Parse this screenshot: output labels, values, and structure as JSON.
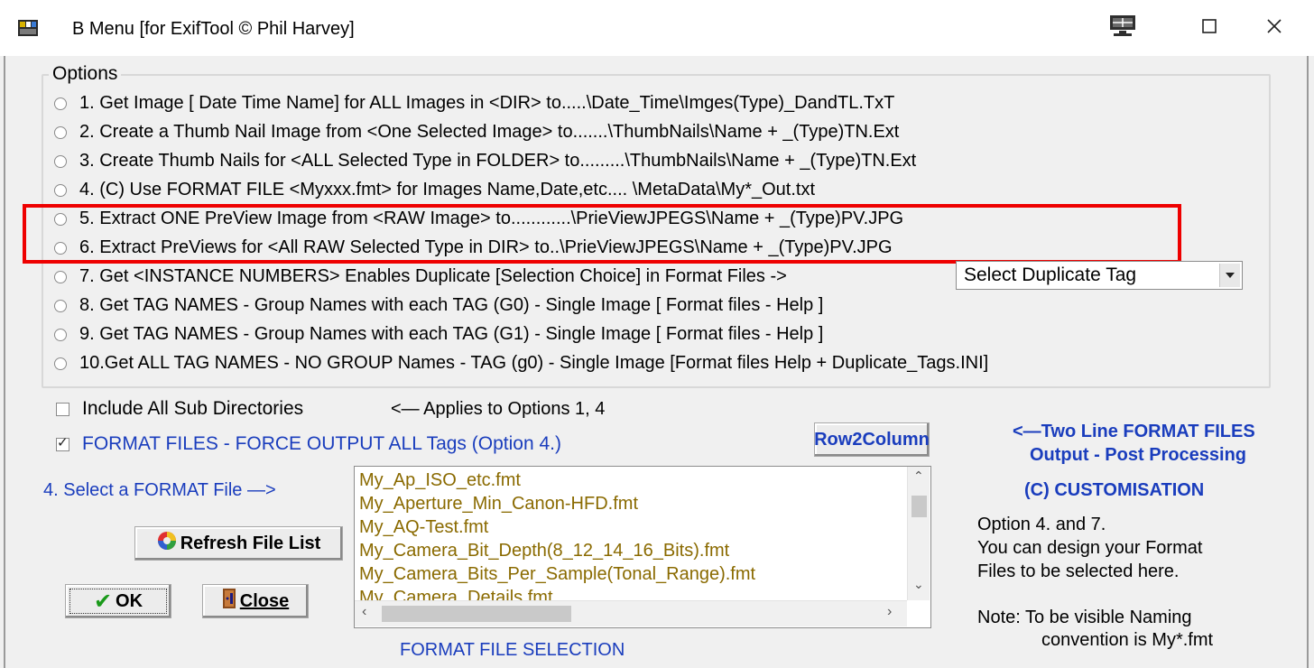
{
  "window": {
    "title": "B Menu  [for ExifTool © Phil Harvey]",
    "min_icon": "minimize-icon",
    "max_icon": "maximize-icon",
    "close_icon": "close-icon"
  },
  "options": {
    "legend": "Options",
    "items": [
      "1. Get Image [ Date Time  Name] for ALL Images in <DIR>    to.....\\Date_Time\\Imges(Type)_DandTL.TxT",
      "2. Create a Thumb Nail Image from <One Selected Image> to.......\\ThumbNails\\Name + _(Type)TN.Ext",
      "3. Create    Thumb Nails for <ALL Selected Type in FOLDER> to.........\\ThumbNails\\Name + _(Type)TN.Ext",
      "4.  (C)  Use FORMAT FILE <Myxxx.fmt> for Images Name,Date,etc.... \\MetaData\\My*_Out.txt",
      "5.  Extract ONE PreView Image from <RAW Image> to............\\PrieViewJPEGS\\Name + _(Type)PV.JPG",
      "6.  Extract PreViews for <All RAW Selected Type in DIR> to..\\PrieViewJPEGS\\Name + _(Type)PV.JPG",
      "7.  Get <INSTANCE NUMBERS> Enables Duplicate [Selection Choice] in Format Files ->",
      "8.  Get TAG NAMES - Group Names with each TAG (G0)  - Single Image   [ Format files - Help ]",
      "9.  Get TAG NAMES - Group Names with each TAG (G1)  - Single Image   [ Format files - Help ]",
      "10.Get ALL TAG NAMES - NO GROUP Names - TAG (g0) - Single Image [Format files Help + Duplicate_Tags.INI]"
    ],
    "duplicate_select": "Select Duplicate Tag"
  },
  "include_subdirs": {
    "label": "Include All Sub Directories",
    "checked": false,
    "note": "<— Applies to Options 1, 4"
  },
  "force_output": {
    "label": "FORMAT FILES - FORCE OUTPUT ALL Tags (Option 4.)",
    "checked": true
  },
  "row2column_label": "Row2Column",
  "two_line": {
    "line1": "<—Two Line FORMAT FILES",
    "line2": "Output - Post Processing"
  },
  "select_format_label": "4.  Select a FORMAT File —>",
  "format_files": [
    "My_Ap_ISO_etc.fmt",
    "My_Aperture_Min_Canon-HFD.fmt",
    "My_AQ-Test.fmt",
    "My_Camera_Bit_Depth(8_12_14_16_Bits).fmt",
    "My_Camera_Bits_Per_Sample(Tonal_Range).fmt",
    "My_Camera_Details.fmt"
  ],
  "customisation": "(C) CUSTOMISATION",
  "note_option": {
    "line1": "Option 4. and 7.",
    "line2": "You can design your Format",
    "line3": "Files to be selected here."
  },
  "note_visible": {
    "line1": "Note: To be visible Naming",
    "line2": "convention is My*.fmt"
  },
  "refresh_label": "Refresh File List",
  "ok_label": "OK",
  "close_label": "Close",
  "format_selection_label": "FORMAT FILE SELECTION",
  "colors": {
    "highlight": "#ee0000",
    "blue_text": "#1a3dbd",
    "list_text": "#8a6a00"
  }
}
